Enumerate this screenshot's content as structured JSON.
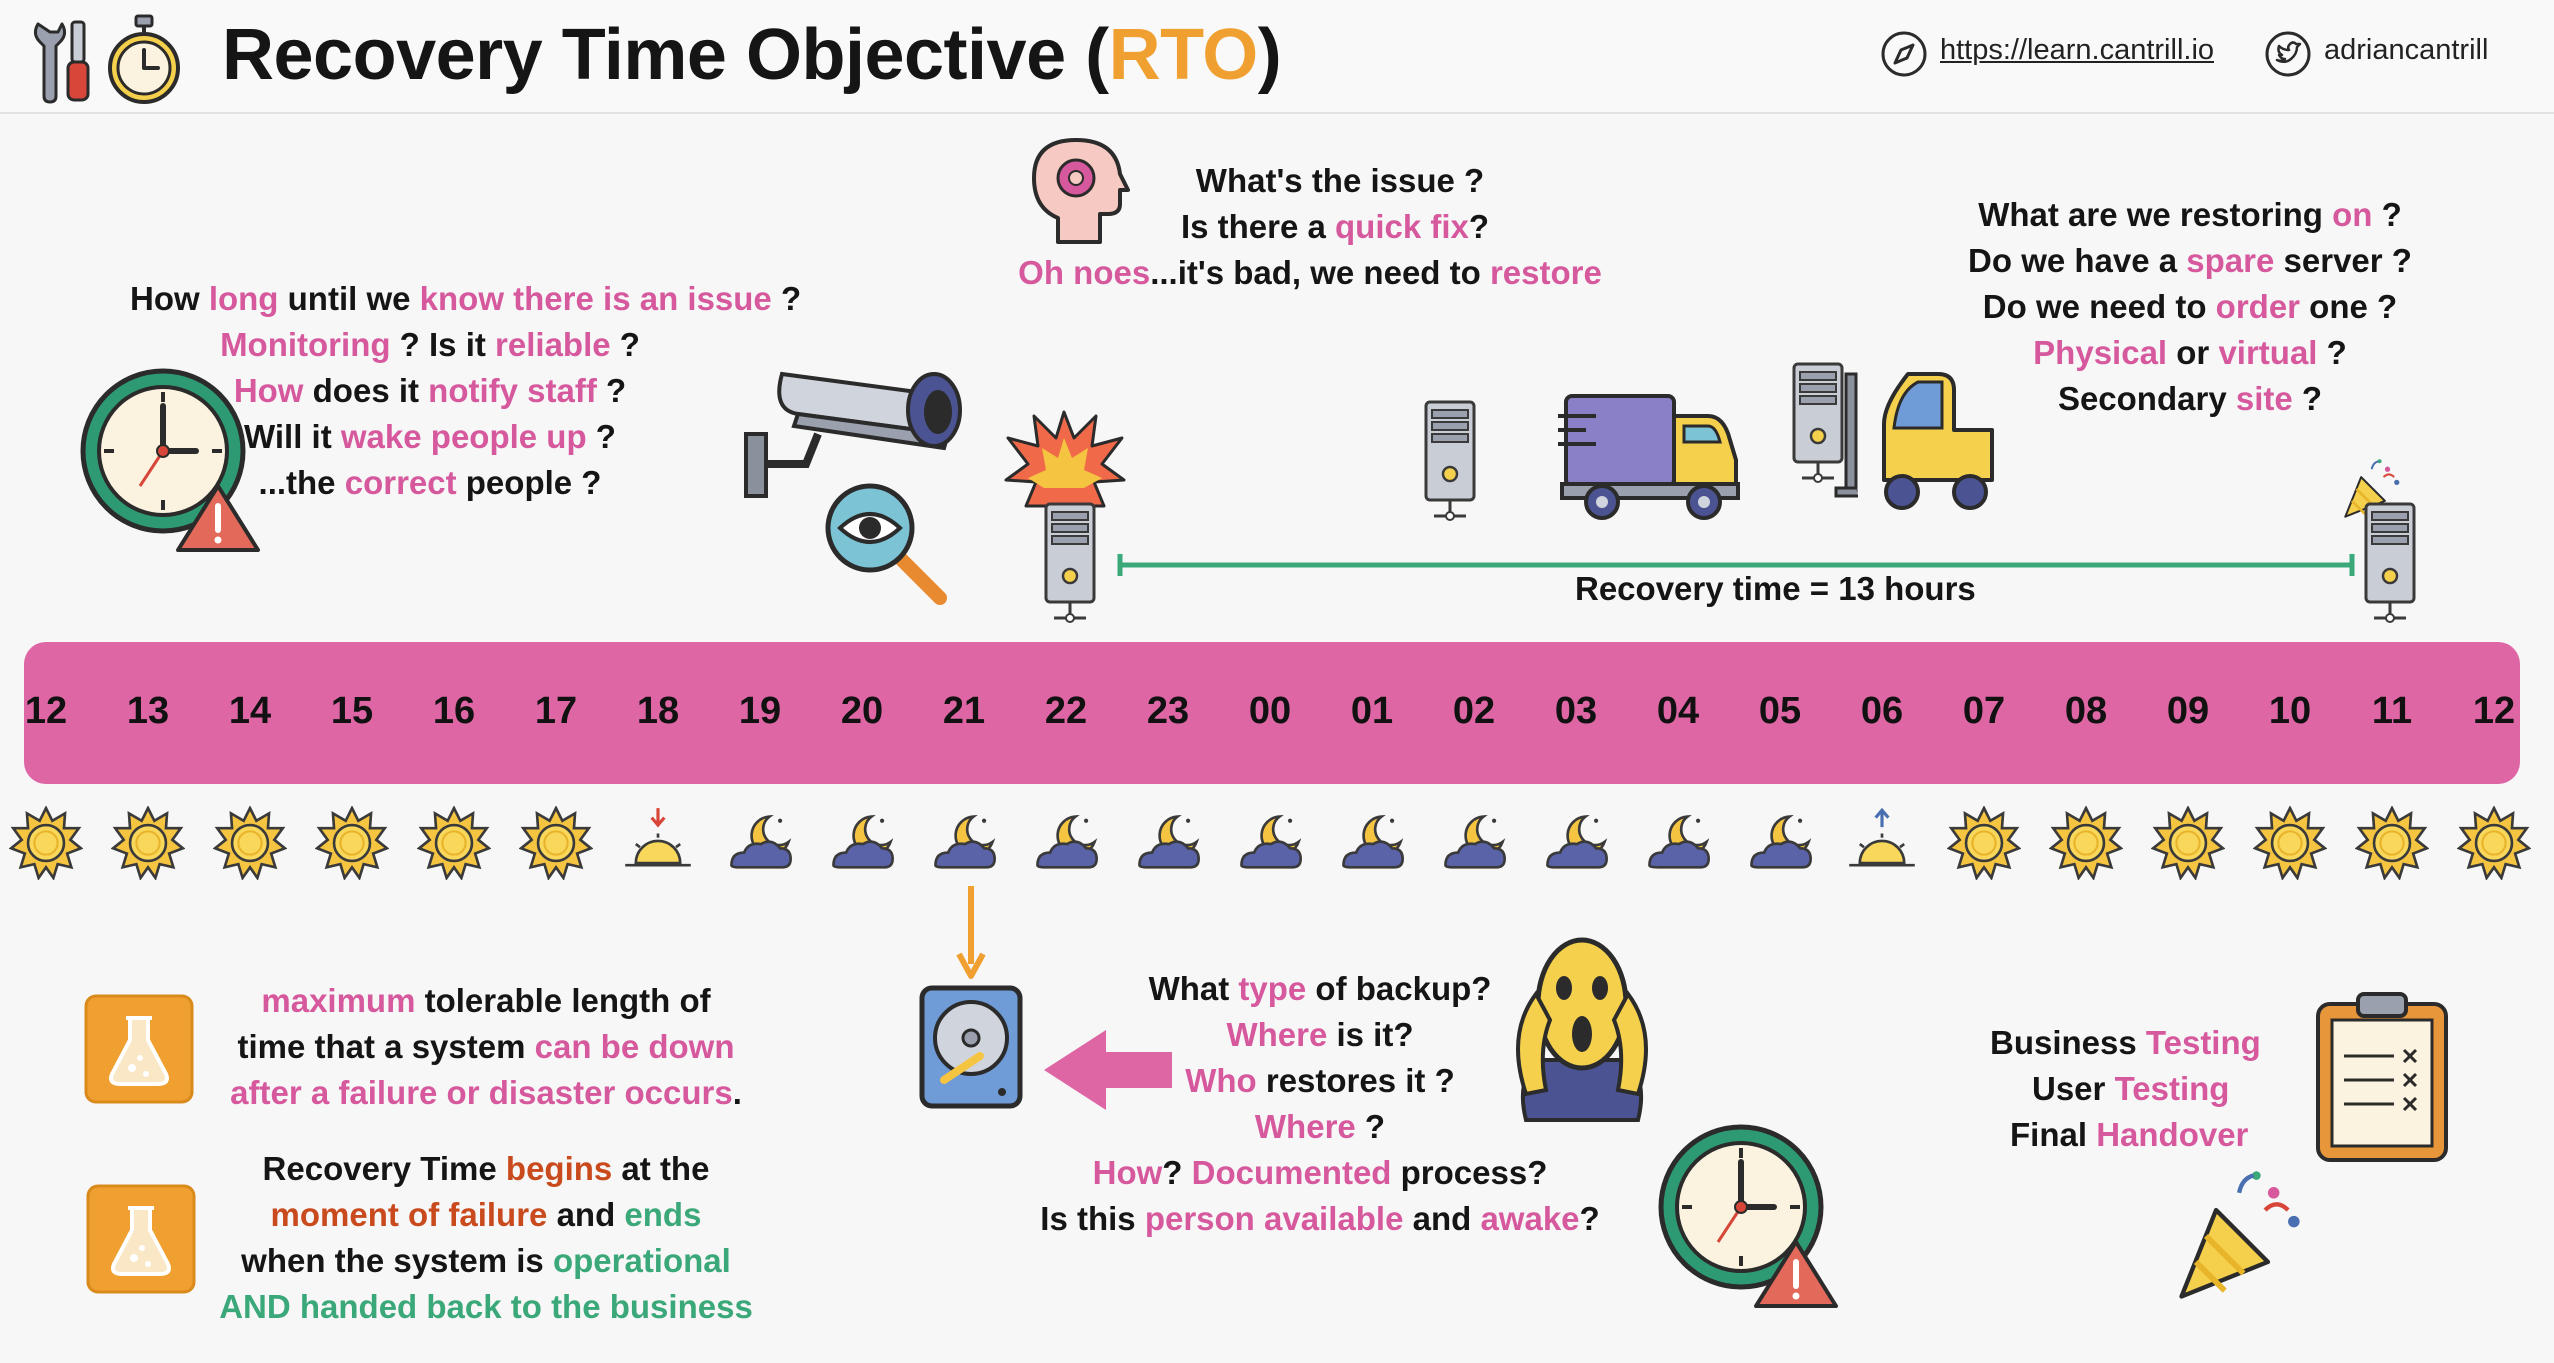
{
  "header": {
    "title_main": "Recovery Time Objective (",
    "title_acronym": "RTO",
    "title_close": ")",
    "website": "https://learn.cantrill.io",
    "twitter": "adriancantrill"
  },
  "detection": {
    "l1": {
      "a": "How ",
      "b": "long",
      "c": " until we ",
      "d": "know there is an issue",
      "e": " ?"
    },
    "l2": {
      "a": "Monitoring",
      "b": " ? Is it ",
      "c": "reliable",
      "d": " ?"
    },
    "l3": {
      "a": "How",
      "b": " does it ",
      "c": "notify staff",
      "d": " ?"
    },
    "l4": {
      "a": "Will it ",
      "b": "wake people up",
      "c": " ?"
    },
    "l5": {
      "a": "...the ",
      "b": "correct",
      "c": " people ?"
    }
  },
  "issue": {
    "l1": "What's the issue ?",
    "l2": {
      "a": "Is there a ",
      "b": "quick fix",
      "c": "?"
    },
    "l3": {
      "a": "Oh noes",
      "b": "...it's bad, we need to ",
      "c": "restore"
    }
  },
  "restore": {
    "l1": {
      "a": "What are we restoring ",
      "b": "on",
      "c": " ?"
    },
    "l2": {
      "a": "Do we have a ",
      "b": "spare",
      "c": " server ?"
    },
    "l3": {
      "a": "Do we need to ",
      "b": "order",
      "c": " one ?"
    },
    "l4": {
      "a": "Physical",
      "b": " or ",
      "c": "virtual",
      "d": " ?"
    },
    "l5": {
      "a": "Secondary ",
      "b": "site",
      "c": " ?"
    }
  },
  "recovery_time_label": "Recovery time = 13 hours",
  "timeline": {
    "hours": [
      "12",
      "13",
      "14",
      "15",
      "16",
      "17",
      "18",
      "19",
      "20",
      "21",
      "22",
      "23",
      "00",
      "01",
      "02",
      "03",
      "04",
      "05",
      "06",
      "07",
      "08",
      "09",
      "10",
      "11",
      "12"
    ],
    "sky": [
      "sun",
      "sun",
      "sun",
      "sun",
      "sun",
      "sun",
      "sunset",
      "night",
      "night",
      "night",
      "night",
      "night",
      "night",
      "night",
      "night",
      "night",
      "night",
      "night",
      "sunrise",
      "sun",
      "sun",
      "sun",
      "sun",
      "sun",
      "sun"
    ]
  },
  "definition": {
    "l1": {
      "a": "maximum",
      "b": " tolerable length of"
    },
    "l2": {
      "a": "time that a system ",
      "b": "can be down"
    },
    "l3": {
      "a": "after a failure or disaster occurs",
      "b": "."
    }
  },
  "begins": {
    "l1": {
      "a": "Recovery Time ",
      "b": "begins",
      "c": " at the"
    },
    "l2": {
      "a": "moment of failure",
      "b": " and ",
      "c": "ends"
    },
    "l3": {
      "a": "when the system is ",
      "b": "operational"
    },
    "l4": "AND handed back to the business"
  },
  "backup": {
    "l1": {
      "a": "What ",
      "b": "type",
      "c": " of backup?"
    },
    "l2": {
      "a": "Where",
      "b": " is it?"
    },
    "l3": {
      "a": "Who",
      "b": " restores it ?"
    },
    "l4": {
      "a": "Where",
      "b": " ?"
    },
    "l5": {
      "a": "How",
      "b": "? ",
      "c": "Documented",
      "d": " process?"
    },
    "l6": {
      "a": "Is this ",
      "b": "person available",
      "c": " and ",
      "d": "awake",
      "e": "?"
    }
  },
  "testing": {
    "l1": {
      "a": "Business ",
      "b": "Testing"
    },
    "l2": {
      "a": "User ",
      "b": "Testing"
    },
    "l3": {
      "a": "Final ",
      "b": "Handover"
    }
  },
  "icons": [
    "tools-icon",
    "stopwatch-icon",
    "compass-icon",
    "twitter-icon",
    "clock-warning-icon",
    "security-camera-icon",
    "magnifier-eye-icon",
    "head-gear-icon",
    "explosion-icon",
    "server-icon",
    "delivery-truck-icon",
    "forklift-icon",
    "party-popper-icon",
    "flask-icon",
    "hard-drive-icon",
    "arrow-left-icon",
    "arrow-down-icon",
    "scream-face-icon",
    "clipboard-icon"
  ],
  "colors": {
    "band": "#de66a4",
    "accent_pink": "#d6589d",
    "accent_orange": "#f0a030",
    "accent_red": "#c94a1d",
    "accent_green": "#3aa879",
    "recovery_line": "#3aa879"
  }
}
